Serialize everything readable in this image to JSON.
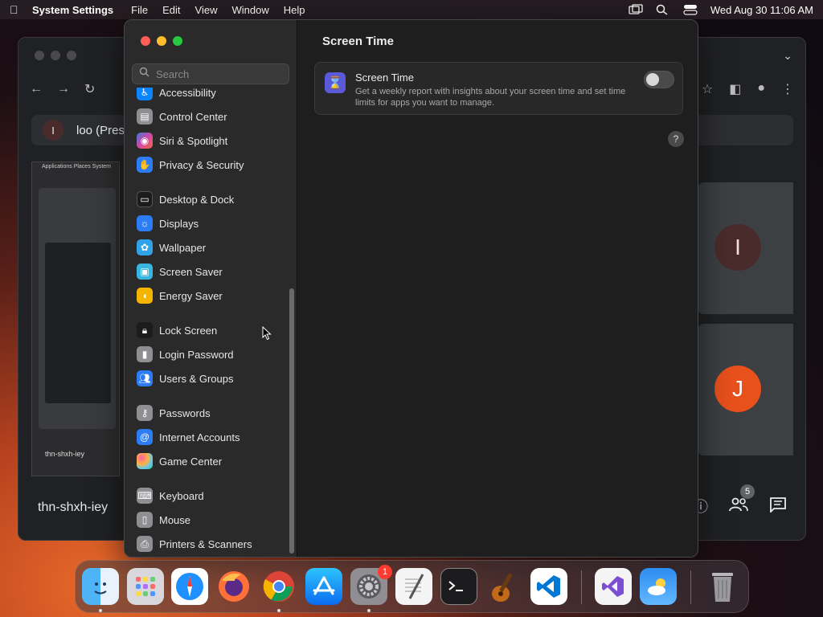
{
  "menubar": {
    "app_name": "System Settings",
    "menus": [
      "File",
      "Edit",
      "View",
      "Window",
      "Help"
    ],
    "datetime": "Wed Aug 30  11:06 AM"
  },
  "browser": {
    "presenting_text": "loo (Pres",
    "presenter_initial": "I",
    "meeting_name": "thn-shxh-iey",
    "participant_1_initial": "I",
    "participant_2_initial": "J",
    "participants_count": "5",
    "mini_menu": "Applications  Places  System",
    "mini_label": "thn-shxh-iey"
  },
  "settings": {
    "search_placeholder": "Search",
    "sidebar": [
      {
        "label": "Accessibility",
        "icon": "accessibility-icon",
        "color": "#0a84ff"
      },
      {
        "label": "Control Center",
        "icon": "control-center-icon",
        "color": "#8e8e93"
      },
      {
        "label": "Siri & Spotlight",
        "icon": "siri-icon",
        "color": "#b04ad8"
      },
      {
        "label": "Privacy & Security",
        "icon": "privacy-hand-icon",
        "color": "#2c7cf6"
      },
      {
        "label": "Desktop & Dock",
        "icon": "desktop-dock-icon",
        "color": "#1c1c1e"
      },
      {
        "label": "Displays",
        "icon": "displays-icon",
        "color": "#2c7cf6"
      },
      {
        "label": "Wallpaper",
        "icon": "wallpaper-icon",
        "color": "#31a3e8"
      },
      {
        "label": "Screen Saver",
        "icon": "screen-saver-icon",
        "color": "#38b6e0"
      },
      {
        "label": "Energy Saver",
        "icon": "energy-saver-icon",
        "color": "#f5b400"
      },
      {
        "label": "Lock Screen",
        "icon": "lock-screen-icon",
        "color": "#1c1c1e"
      },
      {
        "label": "Login Password",
        "icon": "login-password-icon",
        "color": "#8e8e93"
      },
      {
        "label": "Users & Groups",
        "icon": "users-groups-icon",
        "color": "#2c7cf6"
      },
      {
        "label": "Passwords",
        "icon": "passwords-key-icon",
        "color": "#8e8e93"
      },
      {
        "label": "Internet Accounts",
        "icon": "internet-accounts-icon",
        "color": "#2c7cf6"
      },
      {
        "label": "Game Center",
        "icon": "game-center-icon",
        "color": "#e8e8e8"
      },
      {
        "label": "Keyboard",
        "icon": "keyboard-icon",
        "color": "#8e8e93"
      },
      {
        "label": "Mouse",
        "icon": "mouse-icon",
        "color": "#8e8e93"
      },
      {
        "label": "Printers & Scanners",
        "icon": "printers-scanners-icon",
        "color": "#8e8e93"
      }
    ],
    "content": {
      "title": "Screen Time",
      "card_title": "Screen Time",
      "card_description": "Get a weekly report with insights about your screen time and set time limits for apps you want to manage.",
      "toggle_on": false,
      "help": "?"
    }
  },
  "dock": {
    "items": [
      {
        "name": "finder-icon"
      },
      {
        "name": "launchpad-icon"
      },
      {
        "name": "safari-icon"
      },
      {
        "name": "firefox-icon"
      },
      {
        "name": "chrome-icon"
      },
      {
        "name": "app-store-icon"
      },
      {
        "name": "system-settings-icon"
      },
      {
        "name": "textedit-icon"
      },
      {
        "name": "terminal-icon"
      },
      {
        "name": "garageband-icon"
      },
      {
        "name": "vscode-icon"
      },
      {
        "name": "visual-studio-icon"
      },
      {
        "name": "weather-icon"
      },
      {
        "name": "trash-icon"
      }
    ],
    "settings_badge": "1"
  }
}
